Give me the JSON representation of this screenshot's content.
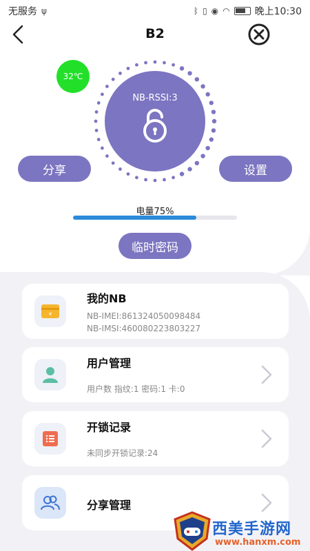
{
  "status_bar": {
    "carrier": "无服务",
    "time": "晚上10:30"
  },
  "nav": {
    "title": "B2"
  },
  "device": {
    "temperature": "32℃",
    "rssi": "NB-RSSI:3",
    "battery_label": "电量75%",
    "battery_percent": 75
  },
  "actions": {
    "share": "分享",
    "settings": "设置",
    "temp_password": "临时密码"
  },
  "cards": {
    "my_nb": {
      "title": "我的NB",
      "imei": "NB-IMEI:861324050098484",
      "imsi": "NB-IMSI:460080223803227"
    },
    "user_mgmt": {
      "title": "用户管理",
      "sub": "用户数 指纹:1 密码:1 卡:0"
    },
    "unlock_log": {
      "title": "开锁记录",
      "sub": "未同步开锁记录:24"
    },
    "share_mgmt": {
      "title": "分享管理"
    }
  },
  "watermark": {
    "title": "西美手游网",
    "url": "www.hanxm.com"
  },
  "colors": {
    "accent": "#7c75c1",
    "temp_badge": "#22e02a",
    "battery_fill": "#2b8ad9",
    "panel_bg": "#f2f2f6"
  }
}
